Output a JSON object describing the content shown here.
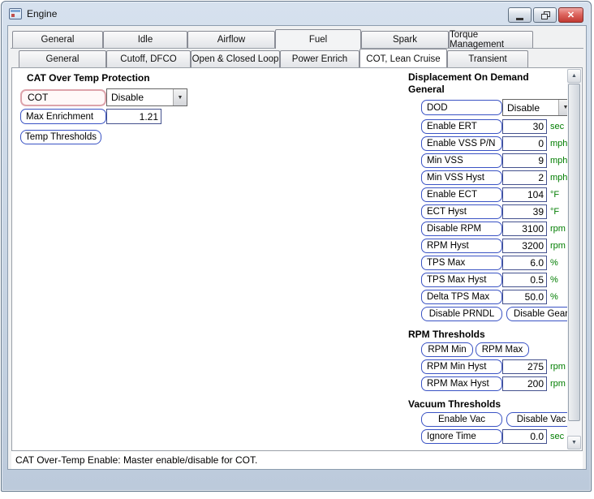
{
  "window": {
    "title": "Engine"
  },
  "icons": {
    "close": "✕",
    "dropdown_arrow": "▼",
    "scroll_up": "▲",
    "scroll_down": "▼"
  },
  "tabs_row1": [
    {
      "label": "General"
    },
    {
      "label": "Idle"
    },
    {
      "label": "Airflow"
    },
    {
      "label": "Fuel",
      "active": true
    },
    {
      "label": "Spark"
    },
    {
      "label": "Torque Management"
    }
  ],
  "tabs_row2": [
    {
      "label": "General"
    },
    {
      "label": "Cutoff, DFCO"
    },
    {
      "label": "Open & Closed Loop"
    },
    {
      "label": "Power Enrich"
    },
    {
      "label": "COT, Lean Cruise",
      "active": true
    },
    {
      "label": "Transient"
    }
  ],
  "left_panel": {
    "heading": "CAT Over Temp Protection",
    "cot": {
      "label": "COT",
      "value": "Disable"
    },
    "max_enrichment": {
      "label": "Max Enrichment",
      "value": "1.21"
    },
    "temp_thresholds_button": "Temp Thresholds"
  },
  "right_panel": {
    "heading": "Displacement On Demand",
    "subheading": "General",
    "dod": {
      "label": "DOD",
      "value": "Disable"
    },
    "fields": [
      {
        "label": "Enable ERT",
        "value": "30",
        "unit": "sec"
      },
      {
        "label": "Enable VSS P/N",
        "value": "0",
        "unit": "mph"
      },
      {
        "label": "Min VSS",
        "value": "9",
        "unit": "mph"
      },
      {
        "label": "Min VSS Hyst",
        "value": "2",
        "unit": "mph"
      },
      {
        "label": "Enable ECT",
        "value": "104",
        "unit": "°F"
      },
      {
        "label": "ECT Hyst",
        "value": "39",
        "unit": "°F"
      },
      {
        "label": "Disable RPM",
        "value": "3100",
        "unit": "rpm"
      },
      {
        "label": "RPM Hyst",
        "value": "3200",
        "unit": "rpm"
      },
      {
        "label": "TPS Max",
        "value": "6.0",
        "unit": "%"
      },
      {
        "label": "TPS Max Hyst",
        "value": "0.5",
        "unit": "%"
      },
      {
        "label": "Delta TPS Max",
        "value": "50.0",
        "unit": "%"
      }
    ],
    "dod_buttons": [
      {
        "label": "Disable PRNDL"
      },
      {
        "label": "Disable Gear"
      }
    ],
    "rpm_section": {
      "heading": "RPM Thresholds",
      "buttons": [
        {
          "label": "RPM Min"
        },
        {
          "label": "RPM Max"
        }
      ],
      "fields": [
        {
          "label": "RPM Min Hyst",
          "value": "275",
          "unit": "rpm"
        },
        {
          "label": "RPM Max Hyst",
          "value": "200",
          "unit": "rpm"
        }
      ]
    },
    "vacuum_section": {
      "heading": "Vacuum Thresholds",
      "buttons": [
        {
          "label": "Enable Vac"
        },
        {
          "label": "Disable Vac"
        }
      ],
      "fields": [
        {
          "label": "Ignore Time",
          "value": "0.0",
          "unit": "sec"
        }
      ]
    }
  },
  "status_bar": {
    "text": "CAT Over-Temp Enable: Master enable/disable for COT."
  },
  "colors": {
    "accent_border": "#3a53c4",
    "unit_green": "#007d00",
    "highlight_pink": "#dda3ab",
    "close_red": "#c23a33"
  }
}
